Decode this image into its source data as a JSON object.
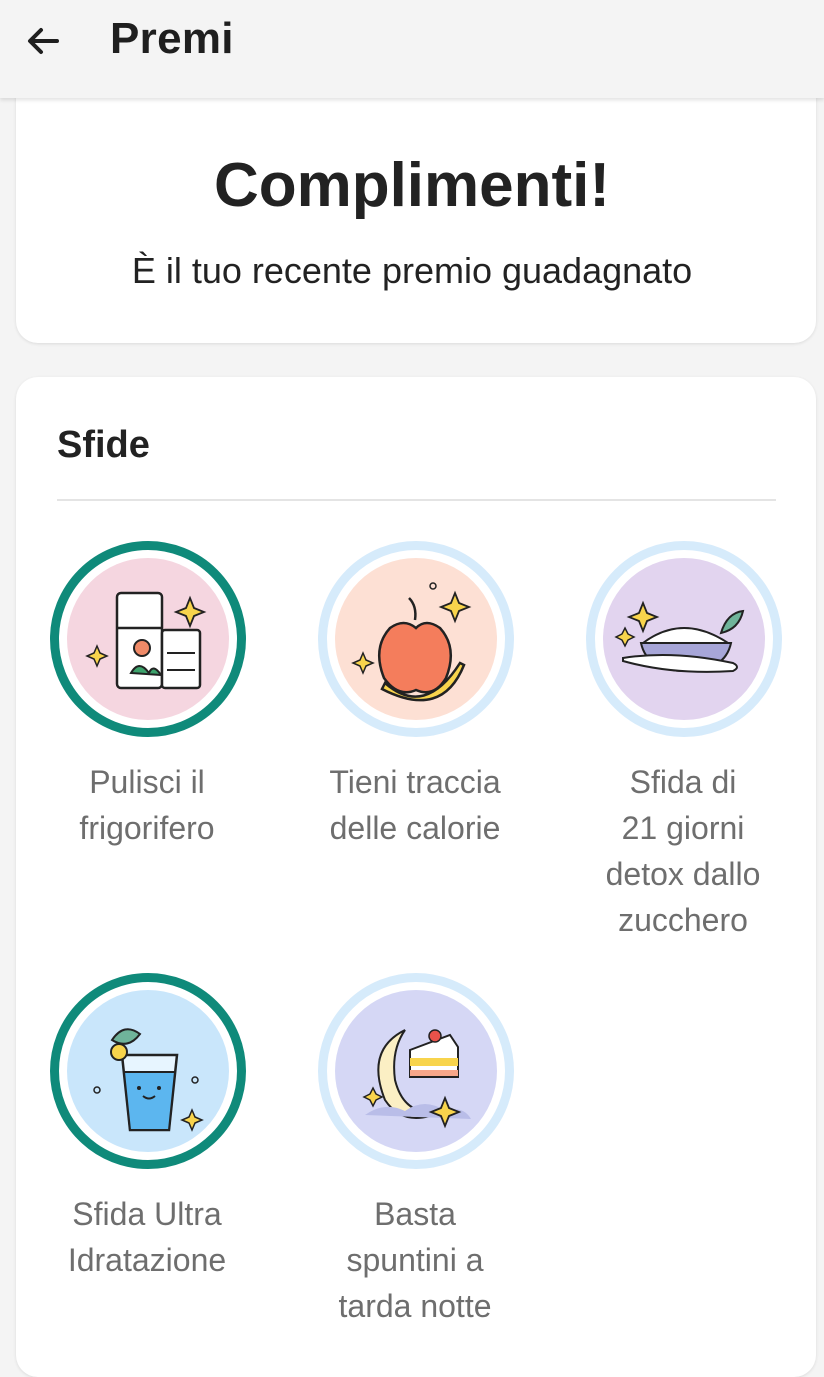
{
  "appbar": {
    "title": "Premi",
    "back_icon": "arrow-left-icon"
  },
  "congrats": {
    "title": "Complimenti!",
    "subtitle": "È il tuo recente premio guadagnato"
  },
  "challenges": {
    "section_title": "Sfide",
    "items": [
      {
        "label": "Pulisci il\nfrigorifero",
        "status": "completed",
        "icon": "fridge-icon",
        "bg": "#f5d6e0"
      },
      {
        "label": "Tieni traccia\ndelle calorie",
        "status": "pending",
        "icon": "apple-banana-icon",
        "bg": "#fde0d4"
      },
      {
        "label": "Sfida di\n21 giorni\ndetox dallo\nzucchero",
        "status": "pending",
        "icon": "sugar-bowl-icon",
        "bg": "#e2d4ef"
      },
      {
        "label": "Sfida Ultra\nIdratazione",
        "status": "completed",
        "icon": "water-glass-icon",
        "bg": "#c9e6fb"
      },
      {
        "label": "Basta\nspuntini a\ntarda notte",
        "status": "pending",
        "icon": "moon-cake-icon",
        "bg": "#d5d7f5"
      }
    ]
  },
  "colors": {
    "completed_ring": "#0f8a7a",
    "pending_ring": "#d6ebfb",
    "background": "#f4f4f4"
  }
}
